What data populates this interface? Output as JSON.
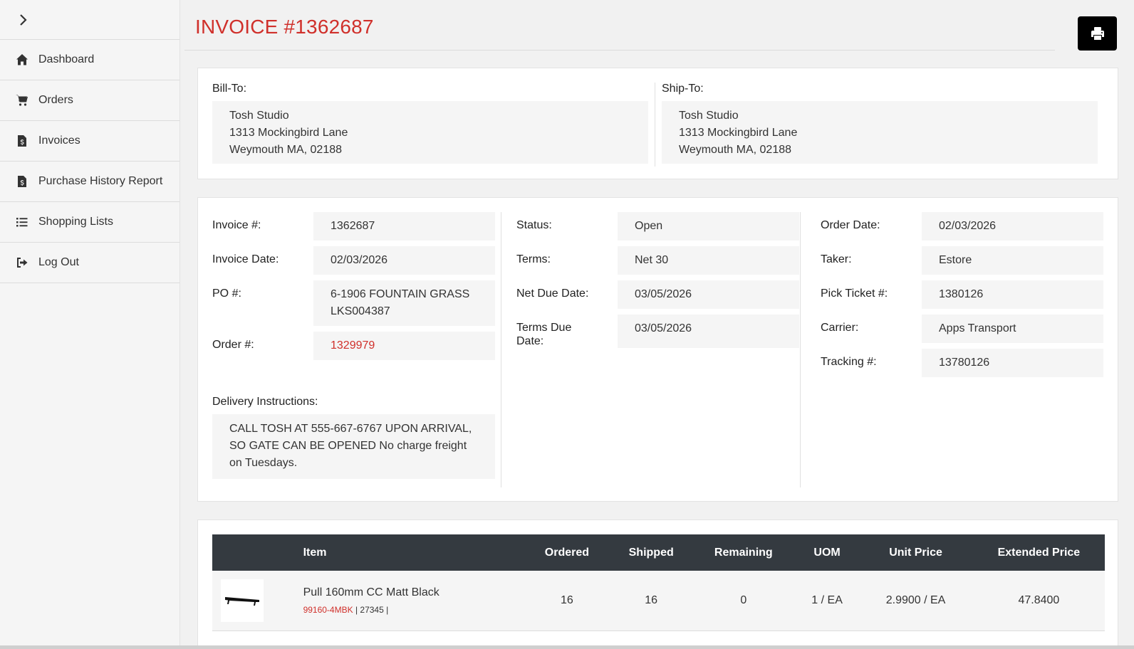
{
  "sidebar": {
    "items": [
      {
        "label": "Dashboard",
        "icon": "home-icon"
      },
      {
        "label": "Orders",
        "icon": "cart-icon"
      },
      {
        "label": "Invoices",
        "icon": "invoice-icon"
      },
      {
        "label": "Purchase History Report",
        "icon": "report-icon"
      },
      {
        "label": "Shopping Lists",
        "icon": "list-icon"
      },
      {
        "label": "Log Out",
        "icon": "logout-icon"
      }
    ]
  },
  "header": {
    "title": "INVOICE #1362687"
  },
  "bill_to": {
    "label": "Bill-To:",
    "line1": "Tosh Studio",
    "line2": "1313 Mockingbird Lane",
    "line3": "Weymouth MA, 02188"
  },
  "ship_to": {
    "label": "Ship-To:",
    "line1": "Tosh Studio",
    "line2": "1313 Mockingbird Lane",
    "line3": "Weymouth MA, 02188"
  },
  "info": {
    "invoice_no": {
      "label": "Invoice #:",
      "value": "1362687"
    },
    "invoice_date": {
      "label": "Invoice Date:",
      "value": "02/03/2026"
    },
    "po_no": {
      "label": "PO #:",
      "value_line1": "6-1906 FOUNTAIN GRASS",
      "value_line2": "LKS004387"
    },
    "order_no": {
      "label": "Order #:",
      "value": "1329979"
    },
    "status": {
      "label": "Status:",
      "value": "Open"
    },
    "terms": {
      "label": "Terms:",
      "value": "Net 30"
    },
    "net_due_date": {
      "label": "Net Due Date:",
      "value": "03/05/2026"
    },
    "terms_due_date": {
      "label_line1": "Terms Due",
      "label_line2": "Date:",
      "value": "03/05/2026"
    },
    "order_date": {
      "label": "Order Date:",
      "value": "02/03/2026"
    },
    "taker": {
      "label": "Taker:",
      "value": "Estore"
    },
    "pick_ticket": {
      "label": "Pick Ticket #:",
      "value": "1380126"
    },
    "carrier": {
      "label": "Carrier:",
      "value": "Apps Transport"
    },
    "tracking": {
      "label": "Tracking #:",
      "value": "13780126"
    },
    "delivery": {
      "label": "Delivery Instructions:",
      "line1": "CALL TOSH AT 555-667-6767 UPON ARRIVAL,",
      "line2": "SO GATE CAN BE OPENED No charge freight",
      "line3": "on Tuesdays."
    }
  },
  "table": {
    "headers": [
      "Item",
      "Ordered",
      "Shipped",
      "Remaining",
      "UOM",
      "Unit Price",
      "Extended Price"
    ],
    "rows": [
      {
        "name": "Pull 160mm CC Matt Black",
        "sku": "99160-4MBK",
        "sub_rest": " | 27345 |",
        "ordered": "16",
        "shipped": "16",
        "remaining": "0",
        "uom": "1 / EA",
        "unit_price": "2.9900 / EA",
        "extended_price": "47.8400"
      }
    ]
  },
  "colors": {
    "accent": "#d0302b",
    "table_header": "#343a40"
  }
}
